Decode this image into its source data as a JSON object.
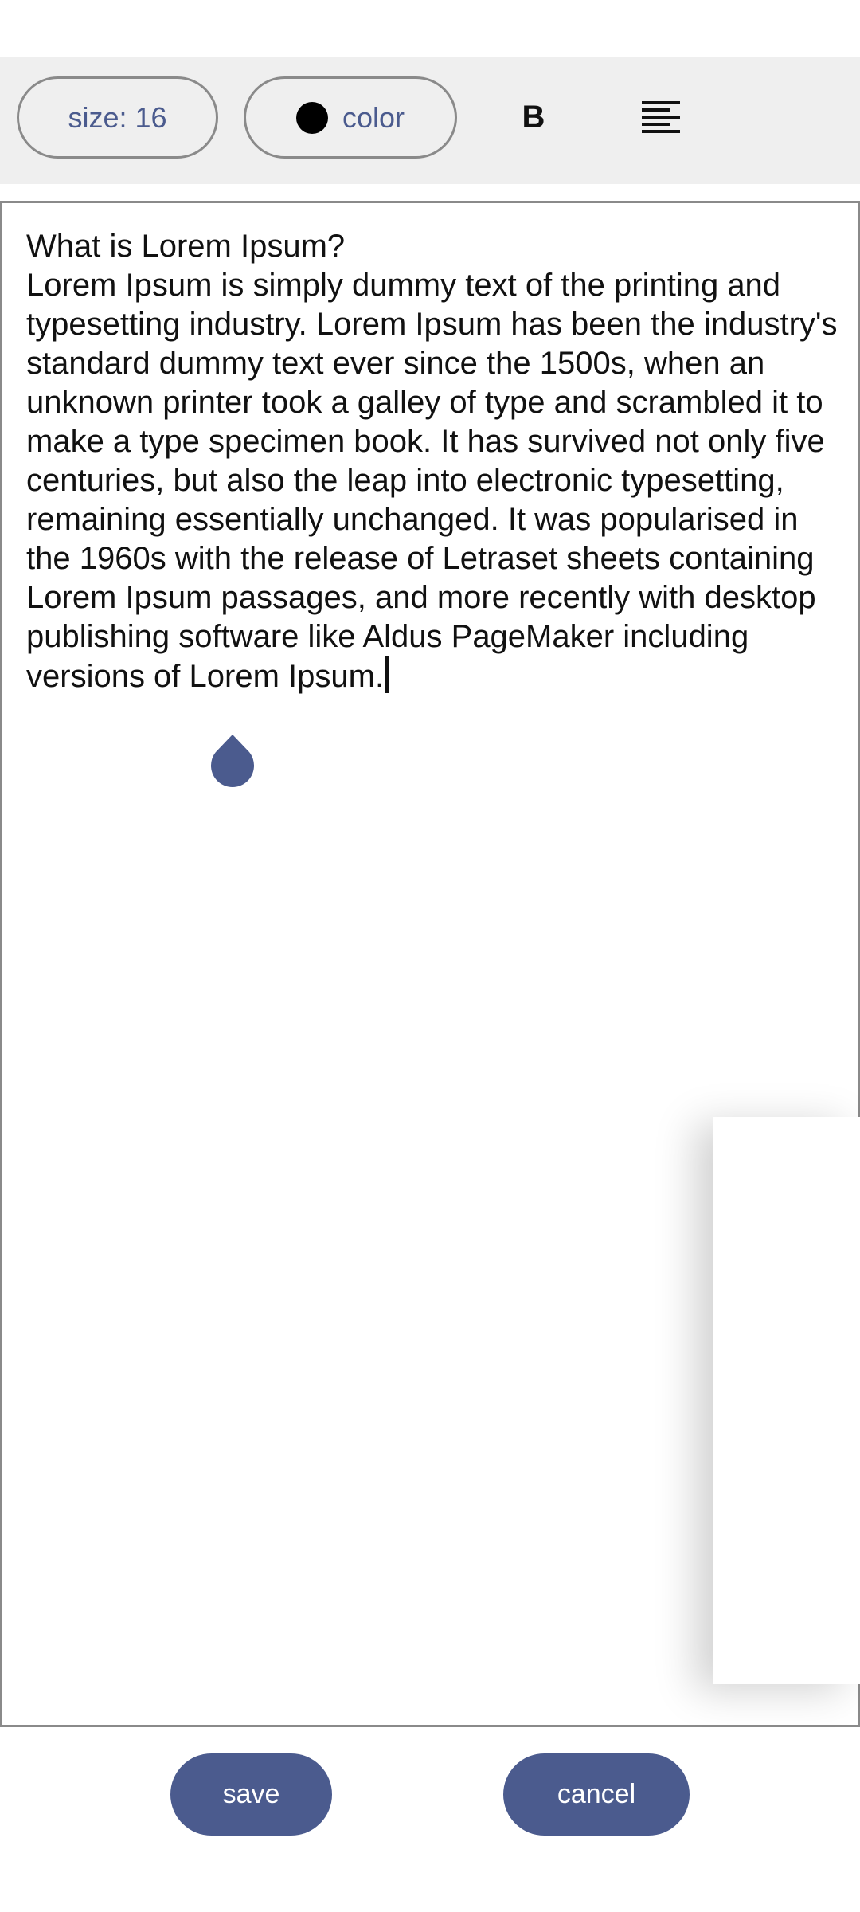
{
  "toolbar": {
    "size_label": "size: 16",
    "color_label": "color",
    "color_swatch": "#000000",
    "bold_label": "B",
    "align_icon": "align-left-icon"
  },
  "editor": {
    "content": "What is Lorem Ipsum?\nLorem Ipsum is simply dummy text of the printing and typesetting industry. Lorem Ipsum has been the industry's standard dummy text ever since the 1500s, when an unknown printer took a galley of type and scrambled it to make a type specimen book. It has survived not only five centuries, but also the leap into electronic typesetting, remaining essentially unchanged. It was popularised in the 1960s with the release of Letraset sheets containing Lorem Ipsum passages, and more recently with desktop publishing software like Aldus PageMaker including versions of Lorem Ipsum."
  },
  "actions": {
    "save_label": "save",
    "cancel_label": "cancel"
  },
  "colors": {
    "accent": "#4b5b8e",
    "toolbar_bg": "#efefef",
    "border": "#8a8a8a"
  }
}
